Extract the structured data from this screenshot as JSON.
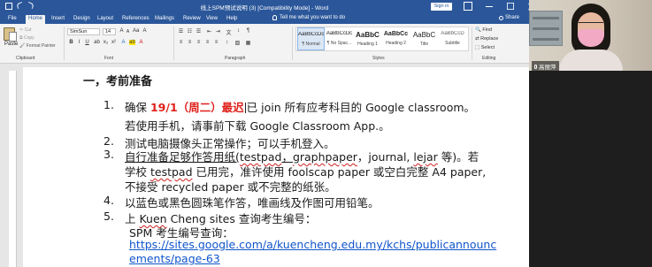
{
  "window": {
    "title": "线上SPM预试说明 (3) [Compatibility Mode]  -  Word",
    "sign_in": "Sign in"
  },
  "tabs": [
    {
      "label": "File"
    },
    {
      "label": "Home"
    },
    {
      "label": "Insert"
    },
    {
      "label": "Design"
    },
    {
      "label": "Layout"
    },
    {
      "label": "References"
    },
    {
      "label": "Mailings"
    },
    {
      "label": "Review"
    },
    {
      "label": "View"
    },
    {
      "label": "Help"
    }
  ],
  "tell_me": "Tell me what you want to do",
  "share": "Share",
  "ribbon": {
    "clipboard": {
      "paste": "Paste",
      "cut": "Cut",
      "copy": "Copy",
      "format_painter": "Format Painter",
      "label": "Clipboard"
    },
    "font": {
      "name": "SimSun",
      "size": "14",
      "label": "Font"
    },
    "paragraph": {
      "label": "Paragraph"
    },
    "styles": {
      "label": "Styles",
      "items": [
        {
          "preview": "AaBbCcDc",
          "name": "¶ Normal"
        },
        {
          "preview": "AaBbCcDc",
          "name": "¶ No Spac..."
        },
        {
          "preview": "AaBbC",
          "name": "Heading 1"
        },
        {
          "preview": "AaBbCc",
          "name": "Heading 2"
        },
        {
          "preview": "AaBbC",
          "name": "Title"
        },
        {
          "preview": "AaBbCcD",
          "name": "Subtitle"
        }
      ]
    },
    "editing": {
      "find": "Find",
      "replace": "Replace",
      "select": "Select",
      "label": "Editing"
    }
  },
  "document": {
    "heading": "一，考前准备",
    "items": [
      {
        "num": "1.",
        "lines": [
          {
            "pre": "确保 ",
            "red": "19/1（周二）最迟",
            "post": "已 join 所有应考科目的 Google classroom。"
          },
          {
            "text": "若使用手机，请事前下载 Google Classroom App.。"
          }
        ]
      },
      {
        "num": "2.",
        "lines": [
          {
            "text": "测试电脑摄像头正常操作；可以手机登入。"
          }
        ]
      },
      {
        "num": "3.",
        "lines": [
          {
            "seg1": "自行准备足够作答用纸(",
            "seg2": "testpad",
            "seg3": "，",
            "seg4": "graphpaper",
            "seg5": "，journal, ",
            "seg6": "lejar",
            "seg7": " 等)。若"
          },
          {
            "seg1": "学校 ",
            "seg2": "testpad",
            "seg3": " 已用完，准许使用 foolscap paper 或空白完整 A4 paper,"
          },
          {
            "text": "不接受 recycled paper 或不完整的纸张。"
          }
        ]
      },
      {
        "num": "4.",
        "lines": [
          {
            "text": "以蓝色或黑色圆珠笔作答，唯画线及作图可用铅笔。"
          }
        ]
      },
      {
        "num": "5.",
        "lines": [
          {
            "seg1": "上 ",
            "seg2": "Kuen",
            "seg3": " Cheng sites 查询考生编号："
          },
          {
            "text": "SPM 考生编号查询："
          },
          {
            "text": "https://sites.google.com/a/kuencheng.edu.my/kchs/publicannounc"
          },
          {
            "text": "ements/page-63"
          }
        ]
      }
    ]
  },
  "webcam": {
    "participant_name": "高丽萍"
  },
  "colors": {
    "word_blue": "#2b579a",
    "ribbon_bg": "#f3f3f3",
    "red_text": "#e0201a",
    "link": "#1155cc"
  }
}
